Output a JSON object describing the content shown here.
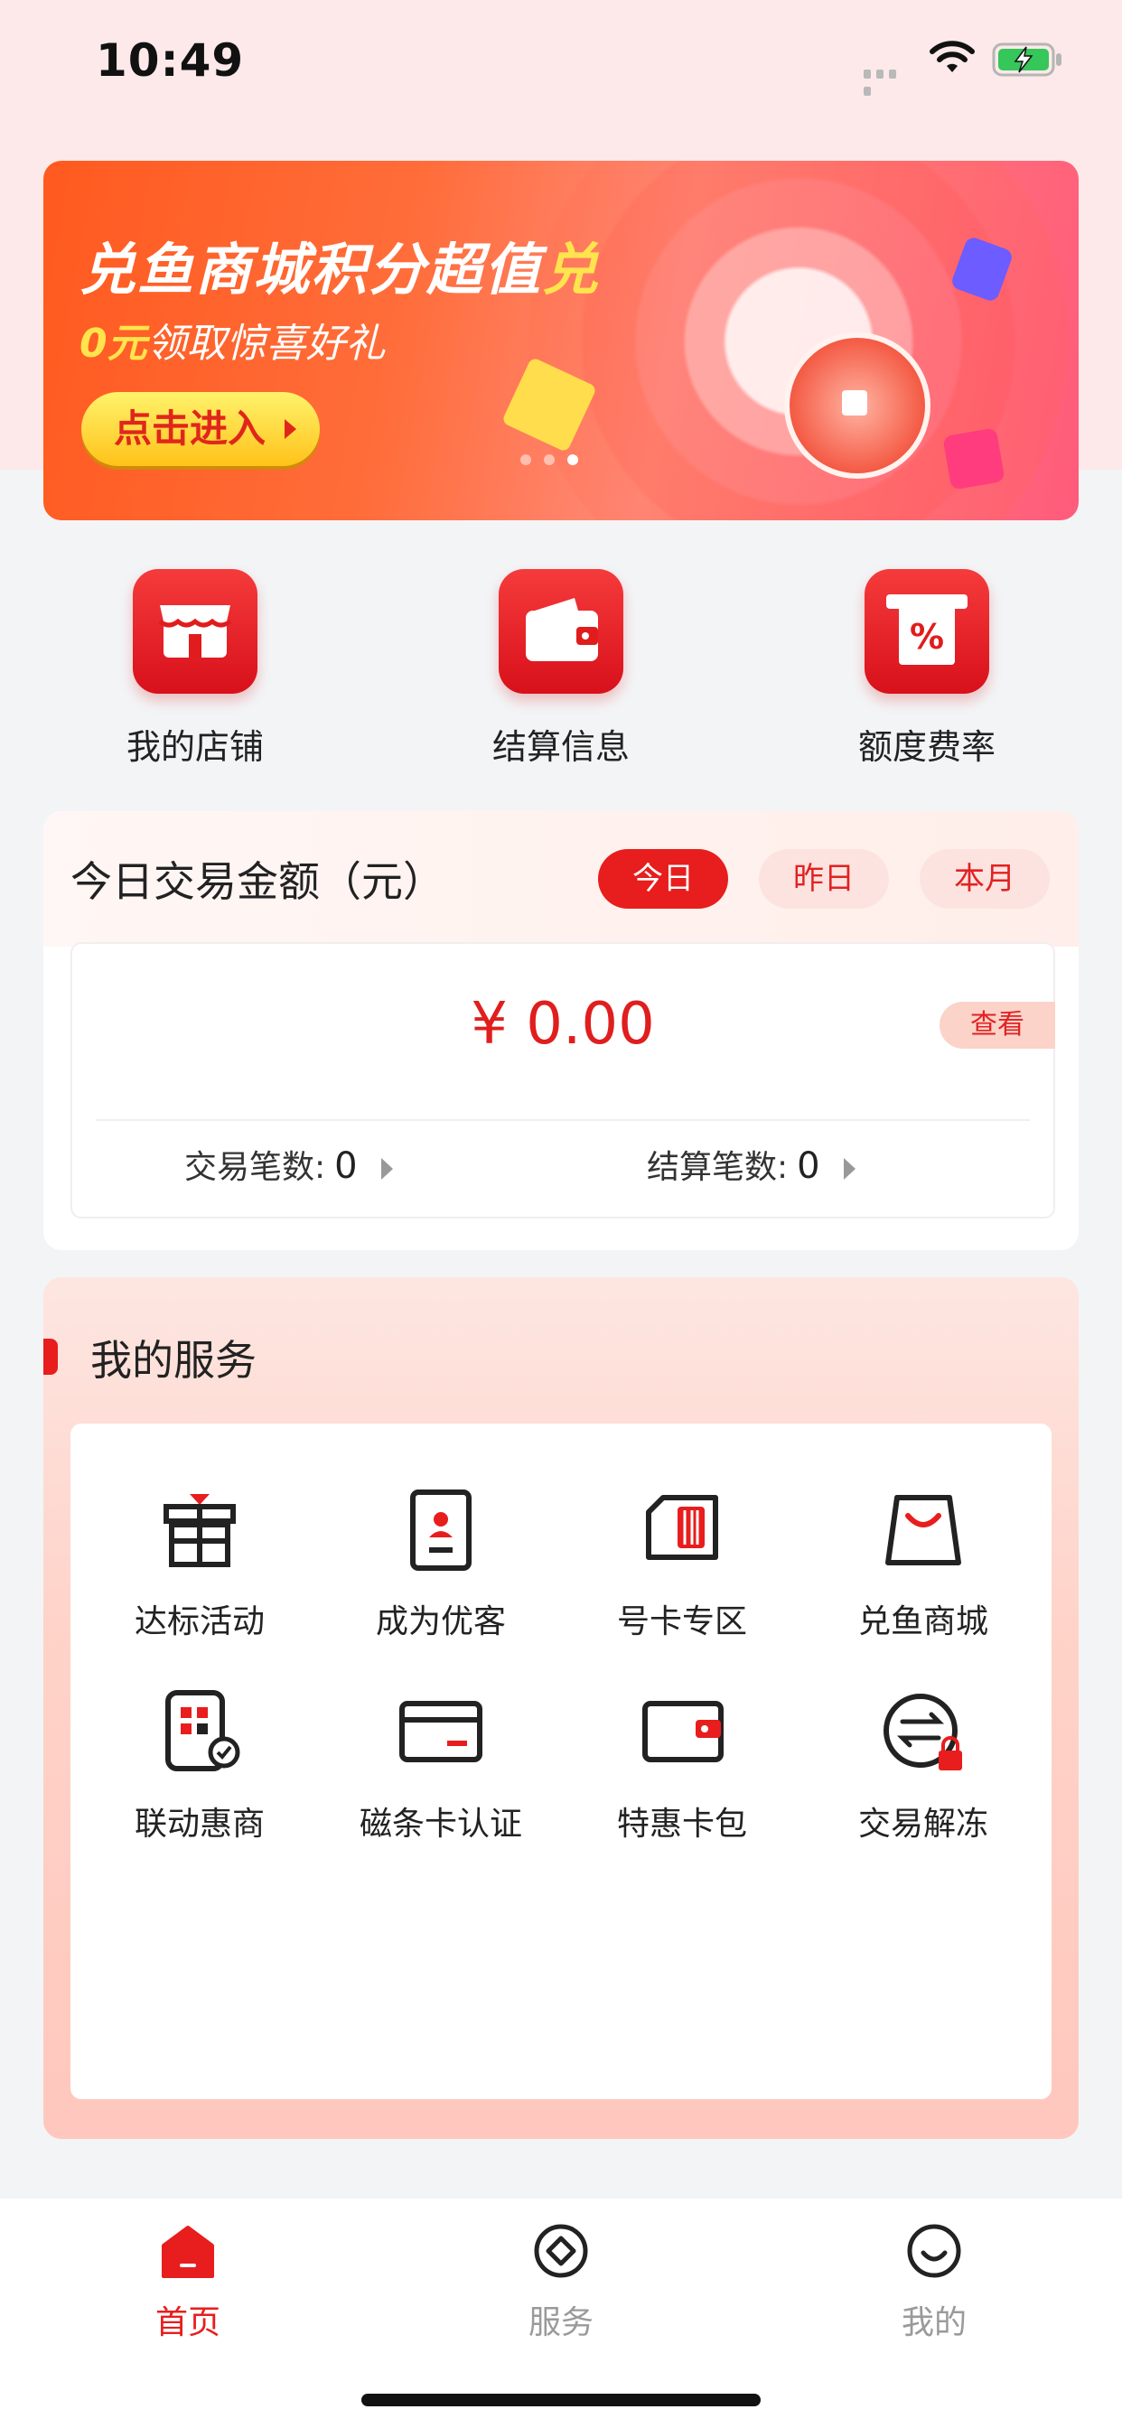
{
  "status_bar": {
    "time": "10:49"
  },
  "banner": {
    "title_main": "兑鱼商城积分超值",
    "title_accent": "兑",
    "subtitle_accent": "0元",
    "subtitle_rest": "领取惊喜好礼",
    "enter_label": "点击进入",
    "page_count": 3,
    "active_page": 3
  },
  "quick_actions": [
    {
      "label": "我的店铺",
      "icon": "store-icon"
    },
    {
      "label": "结算信息",
      "icon": "wallet-icon"
    },
    {
      "label": "额度费率",
      "icon": "percent-receipt-icon"
    }
  ],
  "transactions": {
    "title": "今日交易金额（元）",
    "periods": [
      "今日",
      "昨日",
      "本月"
    ],
    "selected_period": "今日",
    "amount": "¥ 0.00",
    "view_label": "查看",
    "trade_count_label": "交易笔数:",
    "trade_count": "0",
    "settle_count_label": "结算笔数:",
    "settle_count": "0"
  },
  "services": {
    "title": "我的服务",
    "items": [
      {
        "label": "达标活动",
        "icon": "gift-icon"
      },
      {
        "label": "成为优客",
        "icon": "id-card-icon"
      },
      {
        "label": "号卡专区",
        "icon": "sim-card-icon"
      },
      {
        "label": "兑鱼商城",
        "icon": "shopping-bag-icon"
      },
      {
        "label": "联动惠商",
        "icon": "qr-check-icon"
      },
      {
        "label": "磁条卡认证",
        "icon": "bank-card-icon"
      },
      {
        "label": "特惠卡包",
        "icon": "card-wallet-icon"
      },
      {
        "label": "交易解冻",
        "icon": "unlock-exchange-icon"
      }
    ]
  },
  "tabbar": {
    "tabs": [
      {
        "label": "首页",
        "icon": "home-icon",
        "active": true
      },
      {
        "label": "服务",
        "icon": "service-icon",
        "active": false
      },
      {
        "label": "我的",
        "icon": "profile-icon",
        "active": false
      }
    ]
  },
  "colors": {
    "accent": "#e81d1d",
    "page_bg": "#f3f4f6",
    "inactive": "#9a9a9a"
  }
}
